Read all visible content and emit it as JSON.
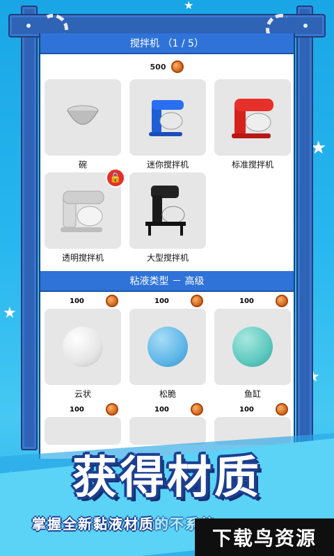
{
  "mixer_section": {
    "header": "搅拌机 （1 / 5）",
    "top_price": "500",
    "items": [
      {
        "label": "碗"
      },
      {
        "label": "迷你搅拌机"
      },
      {
        "label": "标准搅拌机"
      },
      {
        "label": "透明搅拌机",
        "locked": true
      },
      {
        "label": "大型搅拌机"
      }
    ]
  },
  "slime_section": {
    "header": "粘液类型 － 高级",
    "items": [
      {
        "price": "100",
        "label": "云状",
        "color": "#f2f2f2"
      },
      {
        "price": "100",
        "label": "松脆",
        "color": "#5fb7e8"
      },
      {
        "price": "100",
        "label": "鱼缸",
        "color": "#5ec9c0"
      }
    ],
    "next_prices": [
      "100",
      "100",
      "100"
    ]
  },
  "banner": {
    "title": "获得材质",
    "subtitle": "掌握全新黏液材质",
    "subtitle_tail": "的不系统"
  },
  "watermark": "下载鸟资源",
  "colors": {
    "header_blue": "#2f73d8",
    "frame_blue": "#2f63b6",
    "lock_red": "#e5302b",
    "coin": "#d76a1e"
  }
}
